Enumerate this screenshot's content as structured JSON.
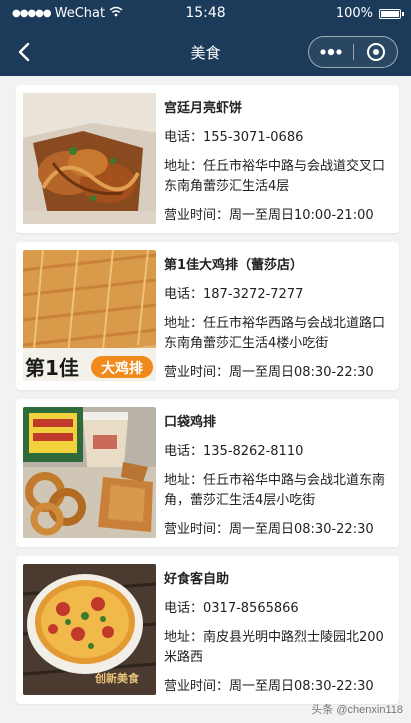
{
  "status_bar": {
    "carrier": "WeChat",
    "time": "15:48",
    "battery_percent_label": "100%",
    "battery_level": 1.0
  },
  "nav": {
    "title": "美食"
  },
  "shops": [
    {
      "name": "宫廷月亮虾饼",
      "phone": "电话：155-3071-0686",
      "address": "地址：任丘市裕华中路与会战道交叉口东南角蕾莎汇生活4层",
      "hours": "营业时间：周一至周日10:00-21:00"
    },
    {
      "name": "第1佳大鸡排（蕾莎店）",
      "phone": "电话：187-3272-7277",
      "address": "地址：任丘市裕华西路与会战北道路口东南角蕾莎汇生活4楼小吃街",
      "hours": "营业时间：周一至周日08:30-22:30",
      "image_text": {
        "brand": "第1佳",
        "product": "大鸡排"
      }
    },
    {
      "name": "口袋鸡排",
      "phone": "电话：135-8262-8110",
      "address": "地址：任丘市裕华中路与会战北道东南角，蕾莎汇生活4层小吃街",
      "hours": "营业时间：周一至周日08:30-22:30"
    },
    {
      "name": "好食客自助",
      "phone": "电话：0317-8565866",
      "address": "地址：南皮县光明中路烈士陵园北200米路西",
      "hours": "营业时间：周一至周日08:30-22:30",
      "image_text": {
        "caption": "创新美食"
      }
    }
  ],
  "watermark": "头条 @chenxin118"
}
